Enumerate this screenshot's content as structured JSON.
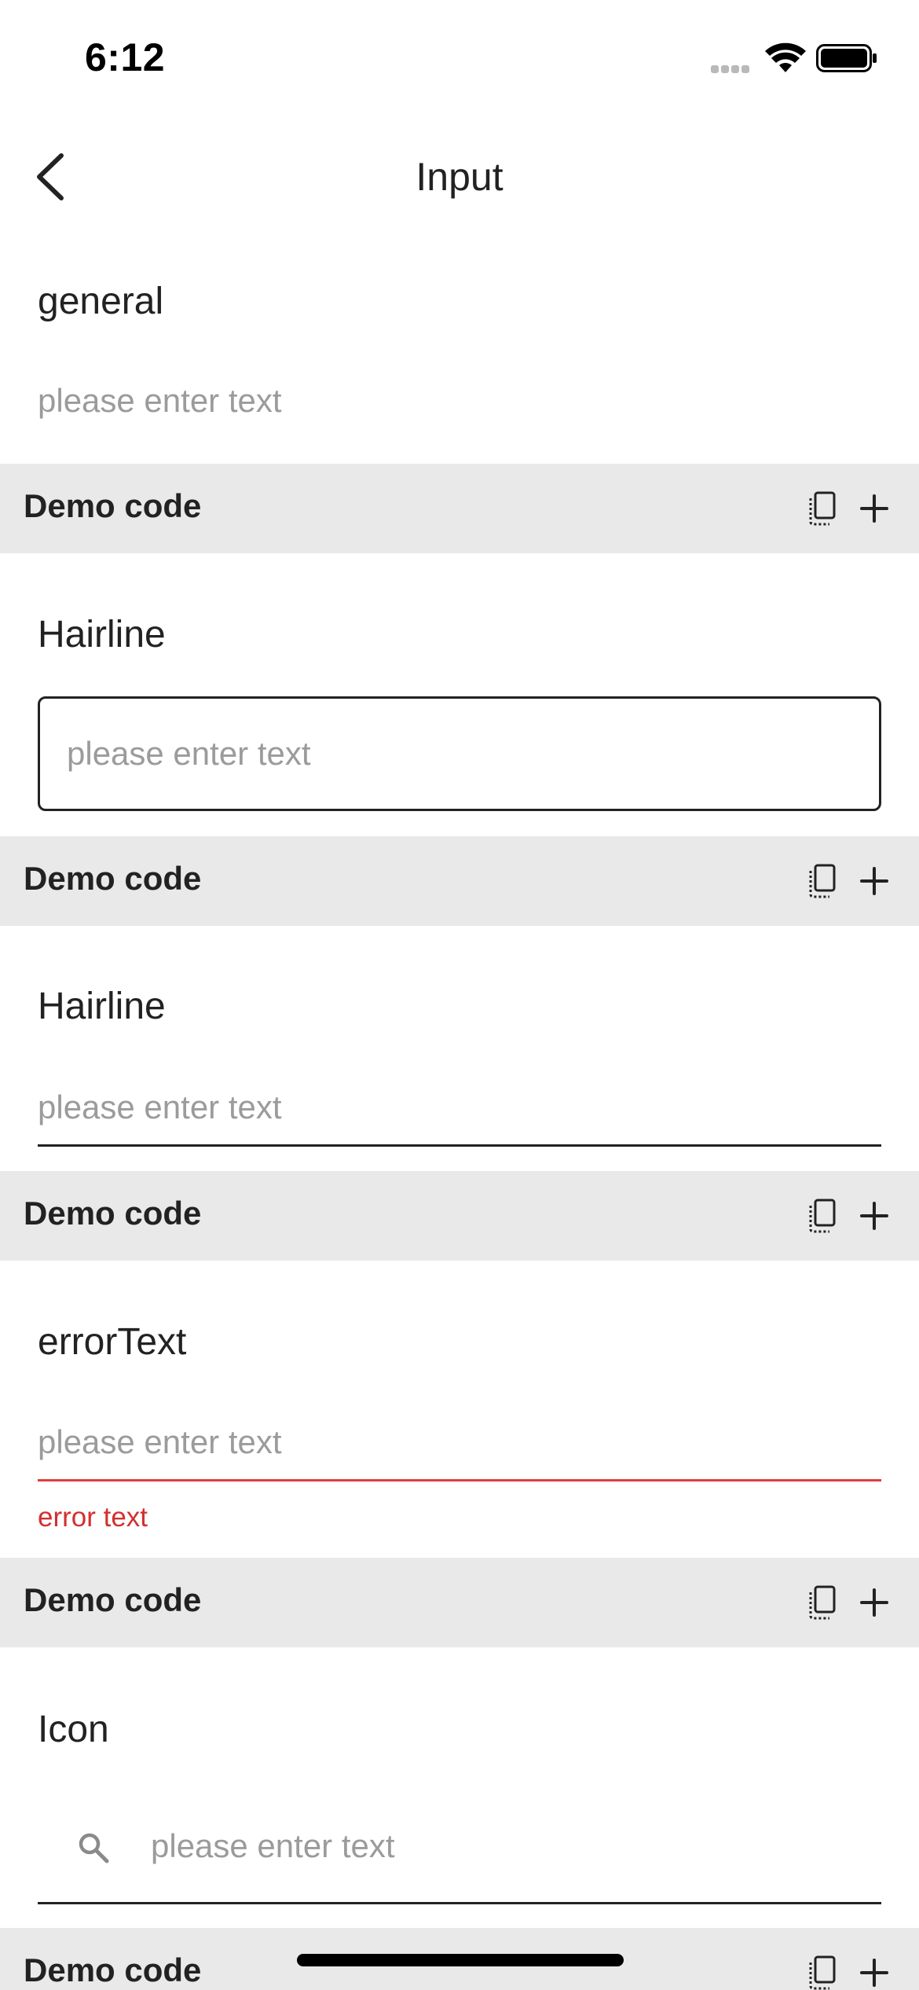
{
  "status_bar": {
    "time": "6:12"
  },
  "nav": {
    "title": "Input"
  },
  "sections": [
    {
      "label": "general",
      "placeholder": "please enter text"
    },
    {
      "label": "Hairline",
      "placeholder": "please enter text"
    },
    {
      "label": "Hairline",
      "placeholder": "please enter text"
    },
    {
      "label": "errorText",
      "placeholder": "please enter text",
      "error": "error text"
    },
    {
      "label": "Icon",
      "placeholder": "please enter text",
      "icon": "search-icon"
    }
  ],
  "demo_code": {
    "label": "Demo code",
    "icons": [
      "copy-icon",
      "plus-icon"
    ]
  },
  "colors": {
    "demo_bar": "#e9e9e9",
    "error": "#d32f2f",
    "placeholder": "#9b9b9b"
  }
}
